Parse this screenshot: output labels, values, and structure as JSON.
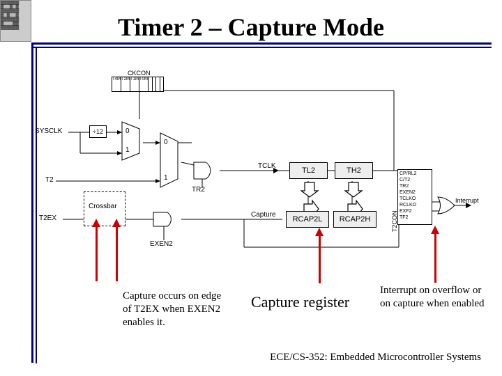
{
  "title": "Timer 2 – Capture Mode",
  "footer": "ECE/CS-352: Embedded Microcontroller Systems",
  "captions": {
    "left": "Capture occurs on edge of T2EX when EXEN2 enables it.",
    "center": "Capture register",
    "right": "Interrupt on overflow or on capture when enabled"
  },
  "labels": {
    "ckcon": "CKCON",
    "sysclk": "SYSCLK",
    "div12": "12",
    "t2": "T2",
    "t2ex": "T2EX",
    "crossbar": "Crossbar",
    "tr2": "TR2",
    "exen2": "EXEN2",
    "tclk": "TCLK",
    "capture": "Capture",
    "tl2": "TL2",
    "th2": "TH2",
    "rcap2l": "RCAP2L",
    "rcap2h": "RCAP2H",
    "interrupt": "Interrupt",
    "t2con": "T2CON",
    "mux0a": "0",
    "mux1a": "1",
    "mux0b": "0",
    "mux1b": "1",
    "ckcon_bits": [
      "T4M",
      "T2M",
      "T1M",
      "T0M"
    ],
    "t2con_bits": [
      "CP/RL2",
      "C/T2",
      "TR2",
      "EXEN2",
      "TCLKO",
      "RCLKO",
      "EXF2",
      "TF2"
    ]
  }
}
